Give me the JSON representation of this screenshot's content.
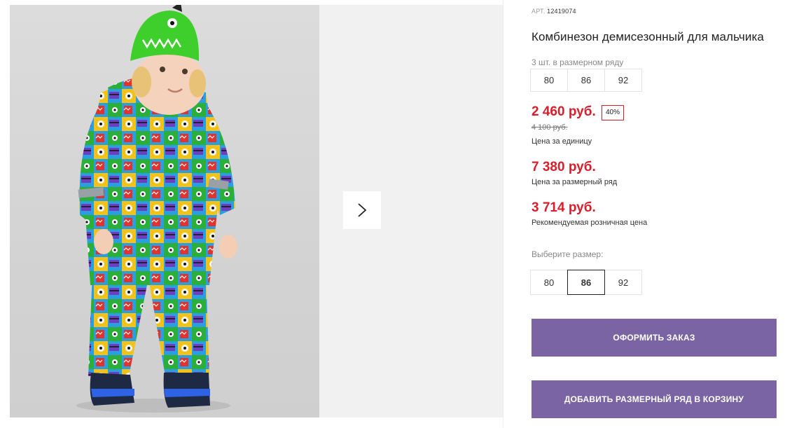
{
  "gallery": {
    "next_icon": "chevron-right-icon",
    "image_alt": "photo of child in a multicolored monster-print jumpsuit and green hat"
  },
  "product": {
    "sku_label": "АРТ.",
    "sku": "12419074",
    "title": "Комбинезон демисезонный для мальчика",
    "pack_label": "3 шт. в размерном ряду",
    "pack_sizes": [
      "80",
      "86",
      "92"
    ],
    "unit_price": "2 460 руб.",
    "discount": "40%",
    "old_price": "4 100 руб.",
    "unit_price_caption": "Цена за единицу",
    "set_price": "7 380 руб.",
    "set_price_caption": "Цена за размерный ряд",
    "retail_price": "3 714 руб.",
    "retail_price_caption": "Рекомендуемая розничная цена",
    "choose_size_label": "Выберите размер:",
    "size_options": [
      "80",
      "86",
      "92"
    ],
    "selected_size": "86"
  },
  "actions": {
    "order_label": "Оформить заказ",
    "add_set_label": "Добавить размерный ряд в корзину"
  },
  "colors": {
    "price_red": "#d81e2c",
    "button_purple": "#7b64a3",
    "hat_green": "#3fcf2c"
  }
}
